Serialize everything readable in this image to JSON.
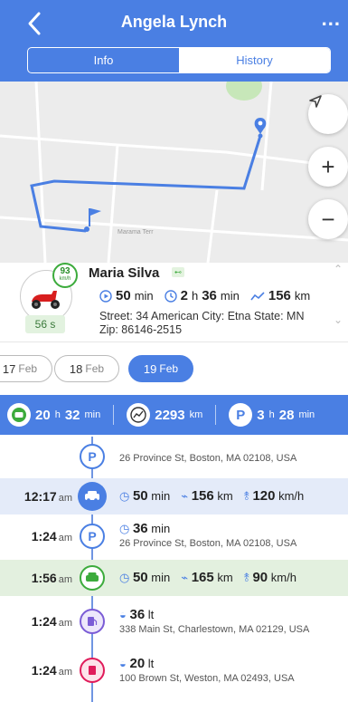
{
  "header": {
    "title": "Angela Lynch",
    "more": "...",
    "tabs": [
      "Info",
      "History"
    ],
    "active_tab": "History"
  },
  "map": {
    "street_label": "Marama Terr"
  },
  "driver": {
    "name": "Maria Silva",
    "speed_value": "93",
    "speed_unit": "km/h",
    "duration_badge": "56 s",
    "stat_time_min": "50",
    "stat_time_min_unit": "min",
    "stat_hours": "2",
    "stat_hours_unit": "h",
    "stat_minutes": "36",
    "stat_minutes_unit": "min",
    "stat_distance": "156",
    "stat_distance_unit": "km",
    "address_line1": "Street: 34 American City: Etna State: MN",
    "address_line2": "Zip: 86146-2515"
  },
  "dates": [
    {
      "day": "17",
      "month": "Feb"
    },
    {
      "day": "18",
      "month": "Feb"
    },
    {
      "day": "19",
      "month": "Feb"
    }
  ],
  "summary": {
    "drive_h": "20",
    "drive_h_unit": "h",
    "drive_min": "32",
    "drive_min_unit": "min",
    "distance": "2293",
    "distance_unit": "km",
    "park_h": "3",
    "park_h_unit": "h",
    "park_min": "28",
    "park_min_unit": "min"
  },
  "timeline": [
    {
      "kind": "parking",
      "time": "",
      "ampm": "",
      "address": "26 Province St, Boston, MA 02108, USA"
    },
    {
      "kind": "trip",
      "time": "12:17",
      "ampm": "am",
      "duration": "50",
      "duration_unit": "min",
      "distance": "156",
      "distance_unit": "km",
      "speed": "120",
      "speed_unit": "km/h"
    },
    {
      "kind": "parking",
      "time": "1:24",
      "ampm": "am",
      "duration": "36",
      "duration_unit": "min",
      "address": "26 Province St, Boston, MA 02108, USA"
    },
    {
      "kind": "trip",
      "time": "1:56",
      "ampm": "am",
      "duration": "50",
      "duration_unit": "min",
      "distance": "165",
      "distance_unit": "km",
      "speed": "90",
      "speed_unit": "km/h"
    },
    {
      "kind": "fuel",
      "time": "1:24",
      "ampm": "am",
      "amount": "36",
      "amount_unit": "lt",
      "address": "338 Main St, Charlestown, MA 02129, USA"
    },
    {
      "kind": "drain",
      "time": "1:24",
      "ampm": "am",
      "amount": "20",
      "amount_unit": "lt",
      "address": "100 Brown St, Weston, MA 02493, USA"
    }
  ],
  "colors": {
    "accent": "#4a7fe3",
    "green": "#3cab3c",
    "purple": "#7b5cd6",
    "red": "#e01b5a"
  }
}
